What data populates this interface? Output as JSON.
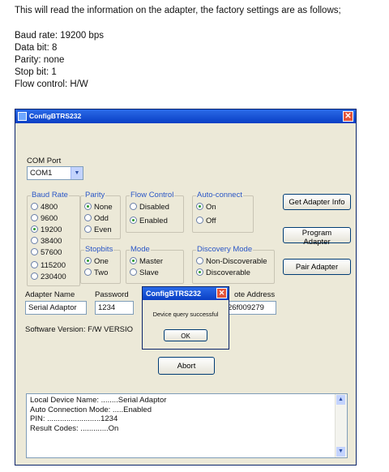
{
  "doc": {
    "intro": "This will read the information on the adapter, the factory settings are as follows;",
    "settings": [
      "Baud rate: 19200 bps",
      "Data bit: 8",
      "Parity: none",
      "Stop bit: 1",
      "Flow control: H/W"
    ]
  },
  "window": {
    "title": "ConfigBTRS232",
    "close_glyph": "✕",
    "com_port": {
      "label": "COM Port",
      "value": "COM1",
      "drop_glyph": "▼"
    },
    "baud_rate": {
      "title": "Baud Rate",
      "options": [
        "4800",
        "9600",
        "19200",
        "38400",
        "57600",
        "115200",
        "230400"
      ],
      "selected": "19200"
    },
    "parity": {
      "title": "Parity",
      "options": [
        "None",
        "Odd",
        "Even"
      ],
      "selected": "None"
    },
    "stopbits": {
      "title": "Stopbits",
      "options": [
        "One",
        "Two"
      ],
      "selected": "One"
    },
    "flow_control": {
      "title": "Flow Control",
      "options": [
        "Disabled",
        "Enabled"
      ],
      "selected": "Enabled"
    },
    "mode": {
      "title": "Mode",
      "options": [
        "Master",
        "Slave"
      ],
      "selected": "Master"
    },
    "auto_connect": {
      "title": "Auto-connect",
      "options": [
        "On",
        "Off"
      ],
      "selected": "On"
    },
    "discovery_mode": {
      "title": "Discovery Mode",
      "options": [
        "Non-Discoverable",
        "Discoverable"
      ],
      "selected": "Discoverable"
    },
    "buttons": {
      "get_info": "Get Adapter Info",
      "program": "Program Adapter",
      "pair": "Pair Adapter",
      "abort": "Abort"
    },
    "adapter_name": {
      "label": "Adapter Name",
      "value": "Serial Adaptor"
    },
    "password": {
      "label": "Password",
      "value": "1234"
    },
    "remote_address": {
      "label": "ote Address",
      "value": "26f009279"
    },
    "software_version": "Software Version: F/W VERSIO",
    "log": [
      "Local Device Name: ........Serial Adaptor",
      "Auto Connection Mode: .....Enabled",
      "PIN: .........................1234",
      "Result Codes: .............On"
    ],
    "scroll_up": "▲",
    "scroll_down": "▼"
  },
  "dialog": {
    "title": "ConfigBTRS232",
    "close_glyph": "✕",
    "message": "Device query successful",
    "ok": "OK"
  }
}
